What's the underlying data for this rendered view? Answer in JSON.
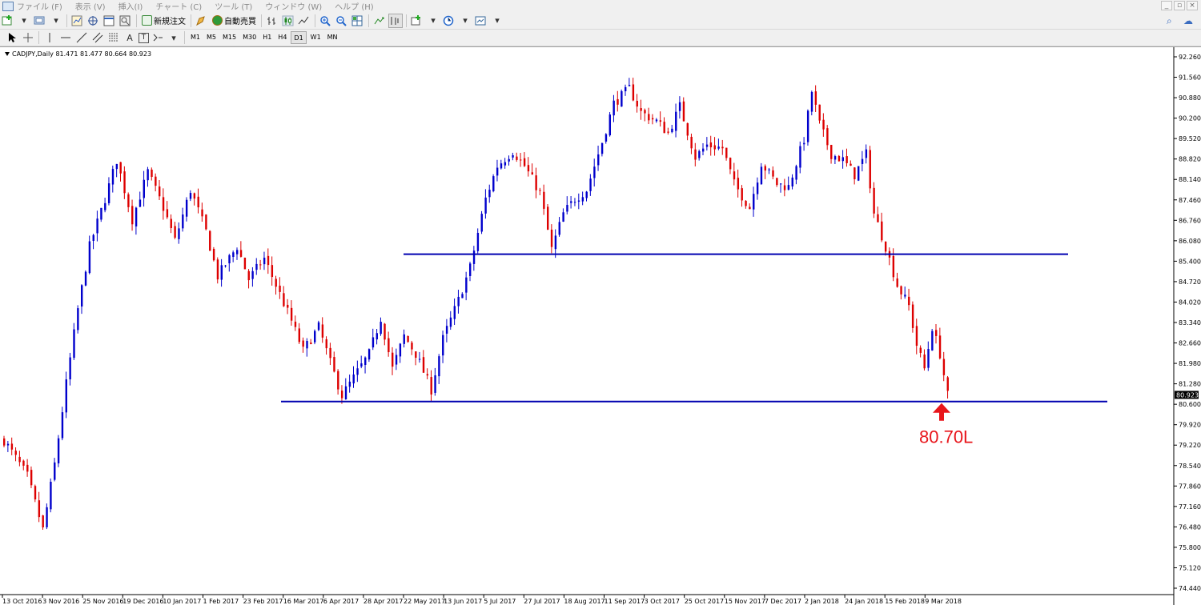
{
  "menu": {
    "items": [
      "ファイル (F)",
      "表示 (V)",
      "挿入(I)",
      "チャート (C)",
      "ツール (T)",
      "ウィンドウ (W)",
      "ヘルプ (H)"
    ],
    "window_controls": [
      "_",
      "▫",
      "×"
    ]
  },
  "toolbar": {
    "new_order_label": "新規注文",
    "auto_trade_label": "自動売買",
    "timeframes": [
      "M1",
      "M5",
      "M15",
      "M30",
      "H1",
      "H4",
      "D1",
      "W1",
      "MN"
    ],
    "active_timeframe": "D1",
    "text_tool_label": "A",
    "text_label_tool_label": "T"
  },
  "chart_data": {
    "type": "candlestick",
    "symbol_header": "CADJPY,Daily  81.471 81.477 80.664 80.923",
    "current_price": "80.923",
    "y_ticks": [
      "92.260",
      "91.560",
      "90.880",
      "90.200",
      "89.520",
      "88.820",
      "88.140",
      "87.460",
      "86.760",
      "86.080",
      "85.400",
      "84.720",
      "84.020",
      "83.340",
      "82.660",
      "81.980",
      "81.280",
      "80.600",
      "79.920",
      "79.220",
      "78.540",
      "77.860",
      "77.160",
      "76.480",
      "75.800",
      "75.120",
      "74.440"
    ],
    "x_ticks": [
      "13 Oct 2016",
      "3 Nov 2016",
      "25 Nov 2016",
      "19 Dec 2016",
      "10 Jan 2017",
      "1 Feb 2017",
      "23 Feb 2017",
      "16 Mar 2017",
      "6 Apr 2017",
      "28 Apr 2017",
      "22 May 2017",
      "13 Jun 2017",
      "5 Jul 2017",
      "27 Jul 2017",
      "18 Aug 2017",
      "11 Sep 2017",
      "3 Oct 2017",
      "25 Oct 2017",
      "15 Nov 2017",
      "7 Dec 2017",
      "2 Jan 2018",
      "24 Jan 2018",
      "15 Feb 2018",
      "9 Mar 2018"
    ],
    "ylim": [
      74.44,
      92.26
    ],
    "bull_color": "#0000cc",
    "bear_color": "#dd0000",
    "support_line_color": "#0000b0",
    "annotation_color": "#e8151b",
    "horizontal_lines": [
      85.64,
      80.7
    ],
    "annotation": {
      "text": "80.70L",
      "price": 80.7
    },
    "close_path": [
      [
        0,
        79.4
      ],
      [
        6,
        78.2
      ],
      [
        10,
        76.4
      ],
      [
        13,
        78.6
      ],
      [
        16,
        81.3
      ],
      [
        19,
        83.8
      ],
      [
        22,
        85.9
      ],
      [
        26,
        87.5
      ],
      [
        29,
        88.8
      ],
      [
        33,
        86.8
      ],
      [
        37,
        88.4
      ],
      [
        41,
        87.2
      ],
      [
        44,
        86.1
      ],
      [
        48,
        87.8
      ],
      [
        52,
        86.4
      ],
      [
        55,
        84.9
      ],
      [
        60,
        85.9
      ],
      [
        63,
        84.8
      ],
      [
        67,
        85.5
      ],
      [
        70,
        84.6
      ],
      [
        74,
        83.4
      ],
      [
        77,
        82.4
      ],
      [
        81,
        83.2
      ],
      [
        84,
        82.0
      ],
      [
        87,
        80.9
      ],
      [
        90,
        81.5
      ],
      [
        94,
        82.3
      ],
      [
        97,
        83.5
      ],
      [
        100,
        81.8
      ],
      [
        103,
        82.9
      ],
      [
        106,
        82.3
      ],
      [
        110,
        81.1
      ],
      [
        113,
        82.8
      ],
      [
        117,
        84.1
      ],
      [
        120,
        85.2
      ],
      [
        124,
        87.5
      ],
      [
        127,
        88.6
      ],
      [
        131,
        89.1
      ],
      [
        134,
        88.6
      ],
      [
        138,
        87.7
      ],
      [
        141,
        85.8
      ],
      [
        144,
        87.0
      ],
      [
        147,
        87.5
      ],
      [
        150,
        87.8
      ],
      [
        154,
        89.4
      ],
      [
        157,
        90.7
      ],
      [
        161,
        91.2
      ],
      [
        164,
        90.4
      ],
      [
        168,
        90.1
      ],
      [
        171,
        89.7
      ],
      [
        174,
        90.6
      ],
      [
        178,
        88.9
      ],
      [
        181,
        89.3
      ],
      [
        185,
        89.2
      ],
      [
        188,
        88.0
      ],
      [
        192,
        87.2
      ],
      [
        195,
        88.7
      ],
      [
        199,
        88.0
      ],
      [
        202,
        87.9
      ],
      [
        206,
        89.5
      ],
      [
        208,
        91.1
      ],
      [
        210,
        90.0
      ],
      [
        213,
        89.0
      ],
      [
        216,
        88.8
      ],
      [
        219,
        88.3
      ],
      [
        222,
        89.0
      ],
      [
        224,
        87.0
      ],
      [
        227,
        85.9
      ],
      [
        230,
        84.6
      ],
      [
        233,
        83.9
      ],
      [
        235,
        82.6
      ],
      [
        237,
        81.8
      ],
      [
        239,
        83.2
      ],
      [
        241,
        82.3
      ],
      [
        243,
        80.9
      ]
    ]
  }
}
